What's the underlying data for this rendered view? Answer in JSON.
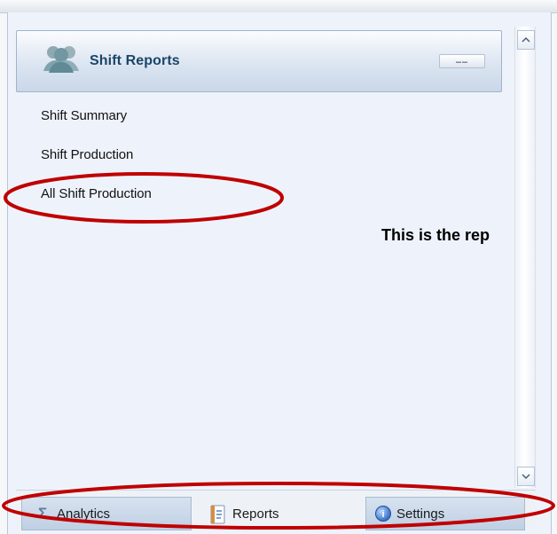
{
  "header": {
    "title": "Shift Reports",
    "more_label": "……",
    "icon": "users-icon"
  },
  "menu": {
    "items": [
      {
        "label": "Shift Summary"
      },
      {
        "label": "Shift Production"
      },
      {
        "label": "All Shift Production"
      }
    ]
  },
  "annotation": {
    "text": "This is the rep"
  },
  "bottom_nav": {
    "tabs": [
      {
        "label": "Analytics",
        "icon": "sigma-icon"
      },
      {
        "label": "Reports",
        "icon": "report-icon"
      },
      {
        "label": "Settings",
        "icon": "info-icon"
      }
    ]
  },
  "scrollbar": {
    "up_icon": "scroll-up-icon",
    "down_icon": "scroll-down-icon"
  },
  "colors": {
    "panel_background": "#eef3fb",
    "header_title": "#1b4568",
    "annotation": "#c00000"
  }
}
